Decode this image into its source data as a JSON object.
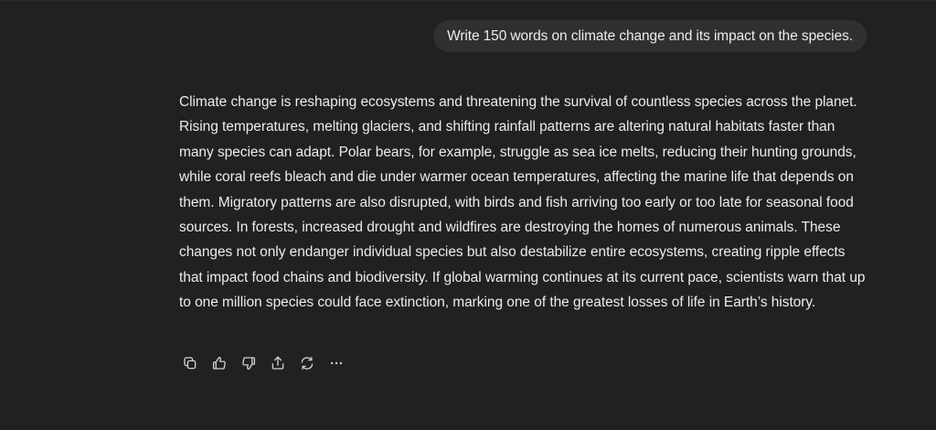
{
  "conversation": {
    "user_message": "Write 150 words on climate change and its impact on the species.",
    "assistant_message": "Climate change is reshaping ecosystems and threatening the survival of countless species across the planet. Rising temperatures, melting glaciers, and shifting rainfall patterns are altering natural habitats faster than many species can adapt. Polar bears, for example, struggle as sea ice melts, reducing their hunting grounds, while coral reefs bleach and die under warmer ocean temperatures, affecting the marine life that depends on them. Migratory patterns are also disrupted, with birds and fish arriving too early or too late for seasonal food sources. In forests, increased drought and wildfires are destroying the homes of numerous animals. These changes not only endanger individual species but also destabilize entire ecosystems, creating ripple effects that impact food chains and biodiversity. If global warming continues at its current pace, scientists warn that up to one million species could face extinction, marking one of the greatest losses of life in Earth’s history."
  },
  "actions": [
    {
      "icon": "copy-icon"
    },
    {
      "icon": "thumbs-up-icon"
    },
    {
      "icon": "thumbs-down-icon"
    },
    {
      "icon": "share-icon"
    },
    {
      "icon": "regenerate-icon"
    },
    {
      "icon": "more-icon"
    }
  ],
  "colors": {
    "background": "#212121",
    "user_bubble": "#303030",
    "text": "#ececec",
    "icon": "#cfcfcf"
  }
}
